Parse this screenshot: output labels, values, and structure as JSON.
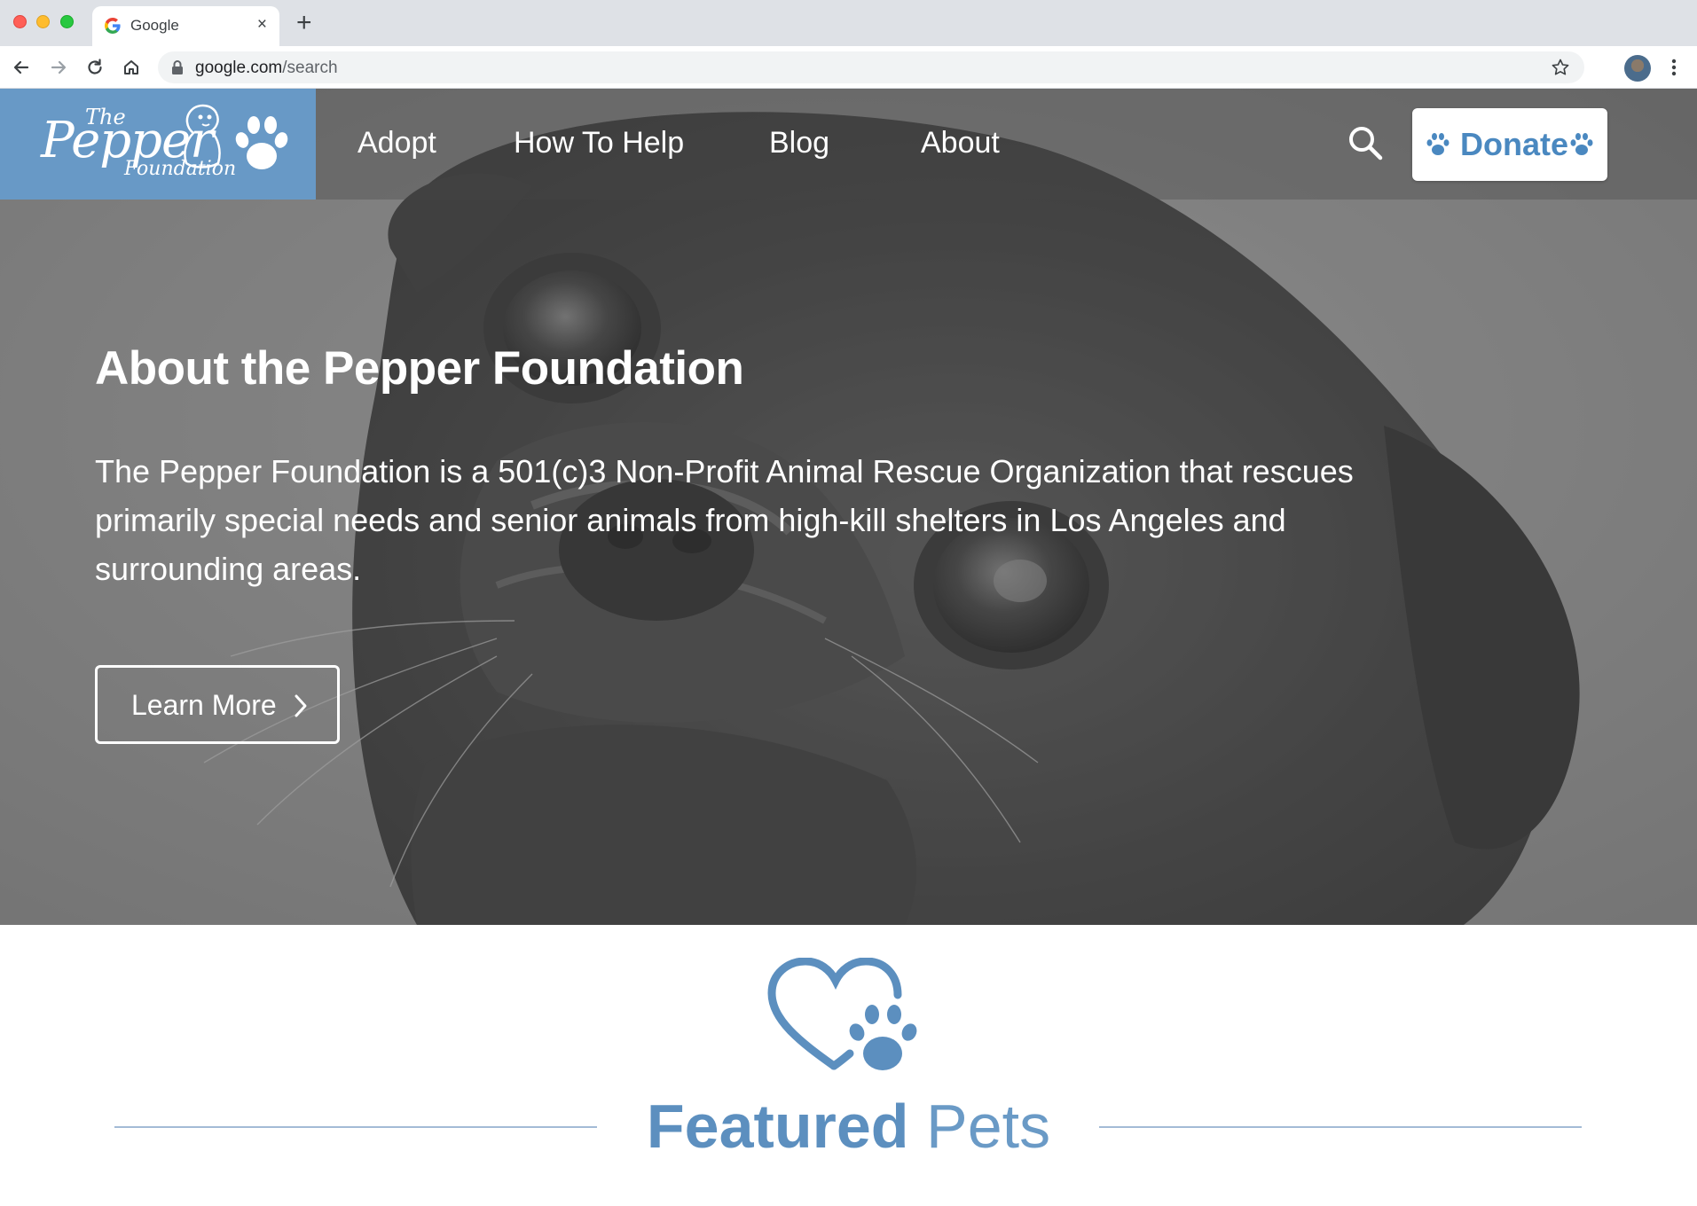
{
  "browser": {
    "tab_title": "Google",
    "tab_close": "×",
    "new_tab": "+",
    "url_host": "google.com",
    "url_path": "/search"
  },
  "site": {
    "logo": {
      "the": "The",
      "pepper": "Pepper",
      "foundation": "Foundation"
    },
    "nav": {
      "items": [
        {
          "label": "Adopt"
        },
        {
          "label": "How To Help"
        },
        {
          "label": "Blog"
        },
        {
          "label": "About"
        }
      ],
      "search_icon": "search-icon",
      "donate_label": "Donate"
    },
    "hero": {
      "title": "About the Pepper Foundation",
      "description": "The Pepper Foundation is a 501(c)3 Non-Profit Animal Rescue Organization that rescues primarily special needs and senior animals from high-kill shelters in Los Angeles and surrounding areas.",
      "cta_label": "Learn More"
    },
    "featured": {
      "title_strong": "Featured",
      "title_light": "Pets"
    }
  },
  "colors": {
    "brand_blue": "#6899c6",
    "donate_text": "#4a88c0",
    "featured_text": "#5c8fbf",
    "rule": "#a3bbd6"
  }
}
